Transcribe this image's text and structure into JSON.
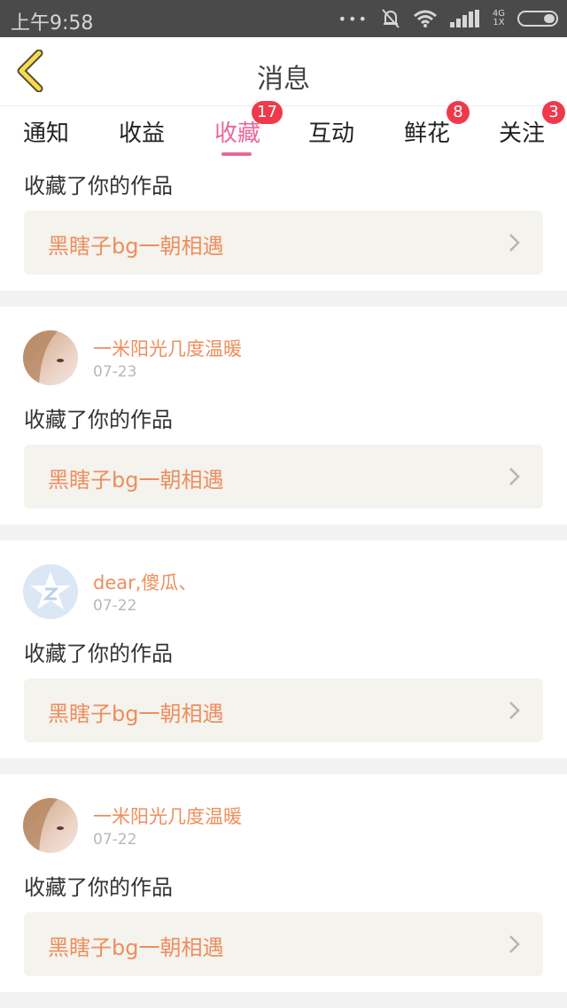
{
  "status_bar": {
    "time": "上午9:58",
    "dots": "•••",
    "network_top": "4G",
    "network_bottom": "1X"
  },
  "header": {
    "title": "消息"
  },
  "tabs": [
    {
      "label": "通知",
      "badge": ""
    },
    {
      "label": "收益",
      "badge": ""
    },
    {
      "label": "收藏",
      "badge": "17",
      "active": true
    },
    {
      "label": "互动",
      "badge": ""
    },
    {
      "label": "鲜花",
      "badge": "8"
    },
    {
      "label": "关注",
      "badge": "3"
    }
  ],
  "colors": {
    "accent_pink": "#e9679c",
    "name_orange": "#ee8e5d",
    "badge_red": "#f0394a"
  },
  "feed": [
    {
      "user": "",
      "date": "",
      "action": "收藏了你的作品",
      "work": "黑瞎子bg一朝相遇",
      "avatar": ""
    },
    {
      "user": "一米阳光几度温暖",
      "date": "07-23",
      "action": "收藏了你的作品",
      "work": "黑瞎子bg一朝相遇",
      "avatar": "photo-avatar"
    },
    {
      "user": "dear,傻瓜、",
      "date": "07-22",
      "action": "收藏了你的作品",
      "work": "黑瞎子bg一朝相遇",
      "avatar": "default-star-avatar"
    },
    {
      "user": "一米阳光几度温暖",
      "date": "07-22",
      "action": "收藏了你的作品",
      "work": "黑瞎子bg一朝相遇",
      "avatar": "photo-avatar"
    }
  ]
}
